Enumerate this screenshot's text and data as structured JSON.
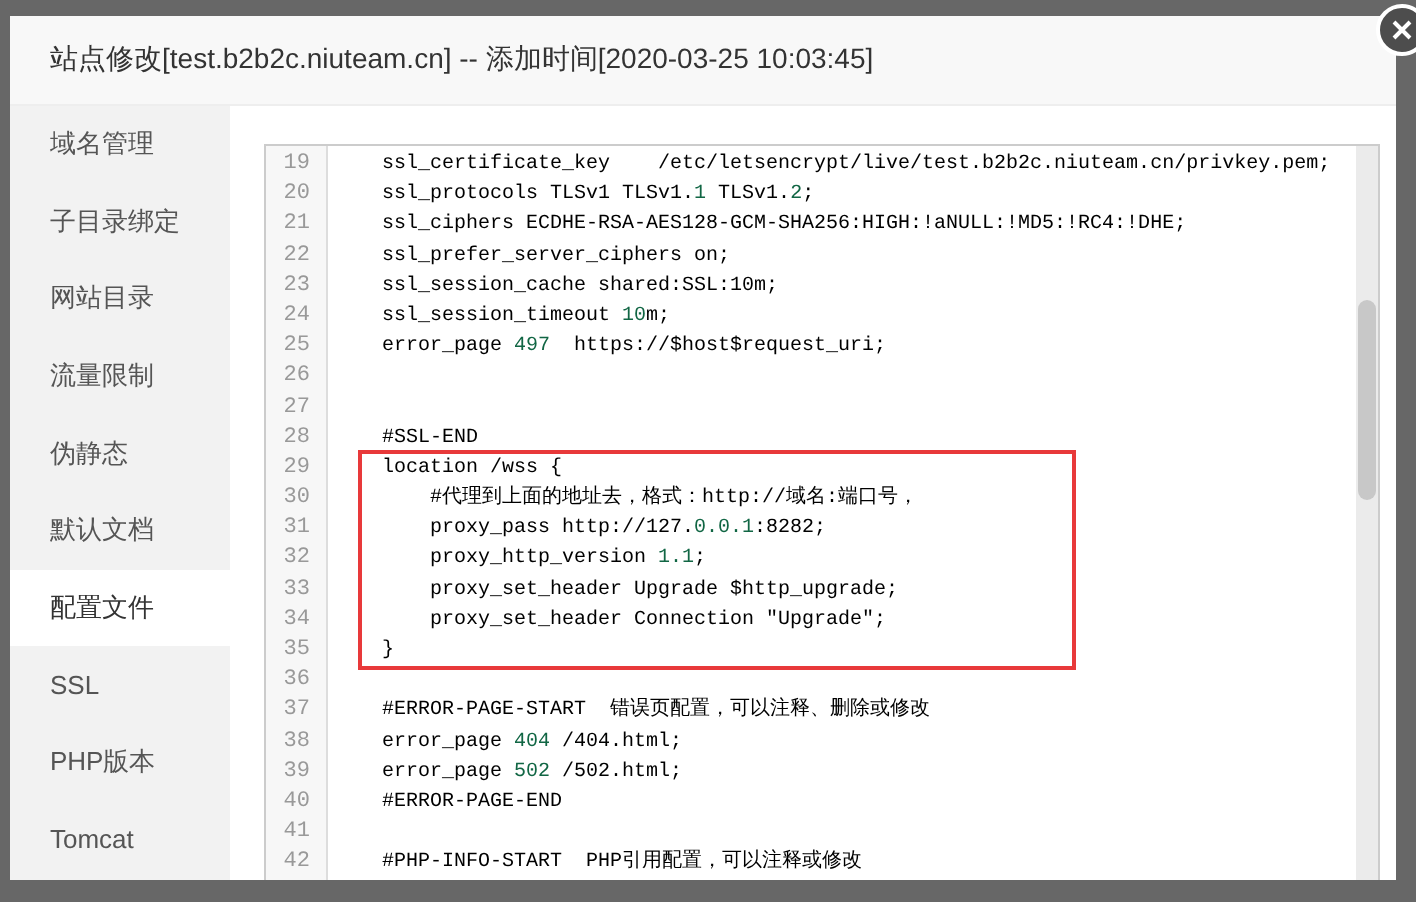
{
  "dialog": {
    "title": "站点修改[test.b2b2c.niuteam.cn] -- 添加时间[2020-03-25 10:03:45]"
  },
  "sidebar": {
    "items": [
      {
        "label": "域名管理",
        "selected": false
      },
      {
        "label": "子目录绑定",
        "selected": false
      },
      {
        "label": "网站目录",
        "selected": false
      },
      {
        "label": "流量限制",
        "selected": false
      },
      {
        "label": "伪静态",
        "selected": false
      },
      {
        "label": "默认文档",
        "selected": false
      },
      {
        "label": "配置文件",
        "selected": true
      },
      {
        "label": "SSL",
        "selected": false
      },
      {
        "label": "PHP版本",
        "selected": false
      },
      {
        "label": "Tomcat",
        "selected": false
      }
    ]
  },
  "editor": {
    "lines": [
      {
        "number": "19",
        "highlighted": false,
        "parts": [
          {
            "kind": "plain",
            "text": "ssl_certificate_key    /etc/letsencrypt/live/test.b2b2c.niuteam.cn/privkey.pem;"
          }
        ]
      },
      {
        "number": "20",
        "highlighted": false,
        "parts": [
          {
            "kind": "plain",
            "text": "ssl_protocols TLSv1 TLSv1."
          },
          {
            "kind": "number",
            "text": "1"
          },
          {
            "kind": "plain",
            "text": " TLSv1."
          },
          {
            "kind": "number",
            "text": "2"
          },
          {
            "kind": "plain",
            "text": ";"
          }
        ]
      },
      {
        "number": "21",
        "highlighted": false,
        "parts": [
          {
            "kind": "plain",
            "text": "ssl_ciphers ECDHE-RSA-AES128-GCM-SHA256:HIGH:!aNULL:!MD5:!RC4:!DHE;"
          }
        ]
      },
      {
        "number": "22",
        "highlighted": false,
        "parts": [
          {
            "kind": "plain",
            "text": "ssl_prefer_server_ciphers on;"
          }
        ]
      },
      {
        "number": "23",
        "highlighted": false,
        "parts": [
          {
            "kind": "plain",
            "text": "ssl_session_cache shared:SSL:10m;"
          }
        ]
      },
      {
        "number": "24",
        "highlighted": false,
        "parts": [
          {
            "kind": "plain",
            "text": "ssl_session_timeout "
          },
          {
            "kind": "number",
            "text": "10"
          },
          {
            "kind": "plain",
            "text": "m;"
          }
        ]
      },
      {
        "number": "25",
        "highlighted": false,
        "parts": [
          {
            "kind": "plain",
            "text": "error_page "
          },
          {
            "kind": "number",
            "text": "497"
          },
          {
            "kind": "plain",
            "text": "  https://$host$request_uri;"
          }
        ]
      },
      {
        "number": "26",
        "highlighted": false
      },
      {
        "number": "27",
        "highlighted": false
      },
      {
        "number": "28",
        "highlighted": false,
        "parts": [
          {
            "kind": "plain",
            "text": "#SSL-END"
          }
        ]
      },
      {
        "number": "29",
        "highlighted": true,
        "parts": [
          {
            "kind": "plain",
            "text": "location /wss {"
          }
        ]
      },
      {
        "number": "30",
        "highlighted": true,
        "parts": [
          {
            "kind": "plain",
            "text": "    #代理到上面的地址去，格式：http://域名:端口号，"
          }
        ]
      },
      {
        "number": "31",
        "highlighted": true,
        "parts": [
          {
            "kind": "plain",
            "text": "    proxy_pass http://127."
          },
          {
            "kind": "number",
            "text": "0.0.1"
          },
          {
            "kind": "plain",
            "text": ":8282;"
          }
        ]
      },
      {
        "number": "32",
        "highlighted": true,
        "parts": [
          {
            "kind": "plain",
            "text": "    proxy_http_version "
          },
          {
            "kind": "number",
            "text": "1.1"
          },
          {
            "kind": "plain",
            "text": ";"
          }
        ]
      },
      {
        "number": "33",
        "highlighted": true,
        "parts": [
          {
            "kind": "plain",
            "text": "    proxy_set_header Upgrade $http_upgrade;"
          }
        ]
      },
      {
        "number": "34",
        "highlighted": true,
        "parts": [
          {
            "kind": "plain",
            "text": "    proxy_set_header Connection \"Upgrade\";"
          }
        ]
      },
      {
        "number": "35",
        "highlighted": true,
        "parts": [
          {
            "kind": "plain",
            "text": "}"
          }
        ]
      },
      {
        "number": "36",
        "highlighted": false
      },
      {
        "number": "37",
        "highlighted": false,
        "parts": [
          {
            "kind": "plain",
            "text": "#ERROR-PAGE-START  错误页配置，可以注释、删除或修改"
          }
        ]
      },
      {
        "number": "38",
        "highlighted": false,
        "parts": [
          {
            "kind": "plain",
            "text": "error_page "
          },
          {
            "kind": "number",
            "text": "404"
          },
          {
            "kind": "plain",
            "text": " /404.html;"
          }
        ]
      },
      {
        "number": "39",
        "highlighted": false,
        "parts": [
          {
            "kind": "plain",
            "text": "error_page "
          },
          {
            "kind": "number",
            "text": "502"
          },
          {
            "kind": "plain",
            "text": " /502.html;"
          }
        ]
      },
      {
        "number": "40",
        "highlighted": false,
        "parts": [
          {
            "kind": "plain",
            "text": "#ERROR-PAGE-END"
          }
        ]
      },
      {
        "number": "41",
        "highlighted": false
      },
      {
        "number": "42",
        "highlighted": false,
        "parts": [
          {
            "kind": "plain",
            "text": "#PHP-INFO-START  PHP引用配置，可以注释或修改"
          }
        ]
      }
    ]
  }
}
